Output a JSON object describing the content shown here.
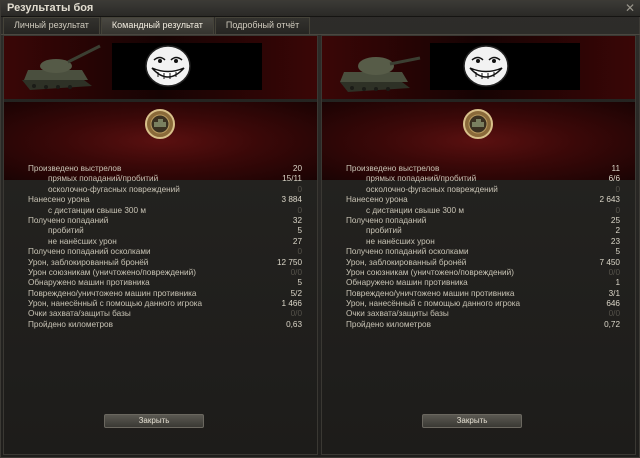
{
  "window": {
    "title": "Результаты боя"
  },
  "tabs": [
    {
      "label": "Личный результат",
      "active": false
    },
    {
      "label": "Командный результат",
      "active": true
    },
    {
      "label": "Подробный отчёт",
      "active": false
    }
  ],
  "colors": {
    "banner_red": "#3a0606",
    "band_red": "#5a1010",
    "text": "#c9c4b5",
    "dim": "#55524a"
  },
  "left": {
    "close_label": "Закрыть",
    "stats": [
      {
        "label": "Произведено выстрелов",
        "value": "20",
        "sub": false
      },
      {
        "label": "прямых попаданий/пробитий",
        "value": "15/11",
        "sub": true
      },
      {
        "label": "осколочно-фугасных повреждений",
        "value": "0",
        "sub": true,
        "dim": true
      },
      {
        "label": "Нанесено урона",
        "value": "3 884",
        "sub": false
      },
      {
        "label": "с дистанции свыше 300 м",
        "value": "0",
        "sub": true,
        "dim": true
      },
      {
        "label": "Получено попаданий",
        "value": "32",
        "sub": false
      },
      {
        "label": "пробитий",
        "value": "5",
        "sub": true
      },
      {
        "label": "не нанёсших урон",
        "value": "27",
        "sub": true
      },
      {
        "label": "Получено попаданий осколками",
        "value": "0",
        "sub": false,
        "dim": true
      },
      {
        "label": "Урон, заблокированный бронёй",
        "value": "12 750",
        "sub": false
      },
      {
        "label": "Урон союзникам (уничтожено/повреждений)",
        "value": "0/0",
        "sub": false,
        "dim": true
      },
      {
        "label": "Обнаружено машин противника",
        "value": "5",
        "sub": false
      },
      {
        "label": "Повреждено/уничтожено машин противника",
        "value": "5/2",
        "sub": false
      },
      {
        "label": "Урон, нанесённый с помощью данного игрока",
        "value": "1 466",
        "sub": false
      },
      {
        "label": "Очки захвата/защиты базы",
        "value": "0/0",
        "sub": false,
        "dim": true
      },
      {
        "label": "Пройдено километров",
        "value": "0,63",
        "sub": false
      }
    ]
  },
  "right": {
    "close_label": "Закрыть",
    "stats": [
      {
        "label": "Произведено выстрелов",
        "value": "11",
        "sub": false
      },
      {
        "label": "прямых попаданий/пробитий",
        "value": "6/6",
        "sub": true
      },
      {
        "label": "осколочно-фугасных повреждений",
        "value": "0",
        "sub": true,
        "dim": true
      },
      {
        "label": "Нанесено урона",
        "value": "2 643",
        "sub": false
      },
      {
        "label": "с дистанции свыше 300 м",
        "value": "0",
        "sub": true,
        "dim": true
      },
      {
        "label": "Получено попаданий",
        "value": "25",
        "sub": false
      },
      {
        "label": "пробитий",
        "value": "2",
        "sub": true
      },
      {
        "label": "не нанёсших урон",
        "value": "23",
        "sub": true
      },
      {
        "label": "Получено попаданий осколками",
        "value": "5",
        "sub": false
      },
      {
        "label": "Урон, заблокированный бронёй",
        "value": "7 450",
        "sub": false
      },
      {
        "label": "Урон союзникам (уничтожено/повреждений)",
        "value": "0/0",
        "sub": false,
        "dim": true
      },
      {
        "label": "Обнаружено машин противника",
        "value": "1",
        "sub": false
      },
      {
        "label": "Повреждено/уничтожено машин противника",
        "value": "3/1",
        "sub": false
      },
      {
        "label": "Урон, нанесённый с помощью данного игрока",
        "value": "646",
        "sub": false
      },
      {
        "label": "Очки захвата/защиты базы",
        "value": "0/0",
        "sub": false,
        "dim": true
      },
      {
        "label": "Пройдено километров",
        "value": "0,72",
        "sub": false
      }
    ]
  },
  "icons": {
    "tank": "tank-icon",
    "troll": "trollface-icon",
    "medal": "medal-icon"
  }
}
